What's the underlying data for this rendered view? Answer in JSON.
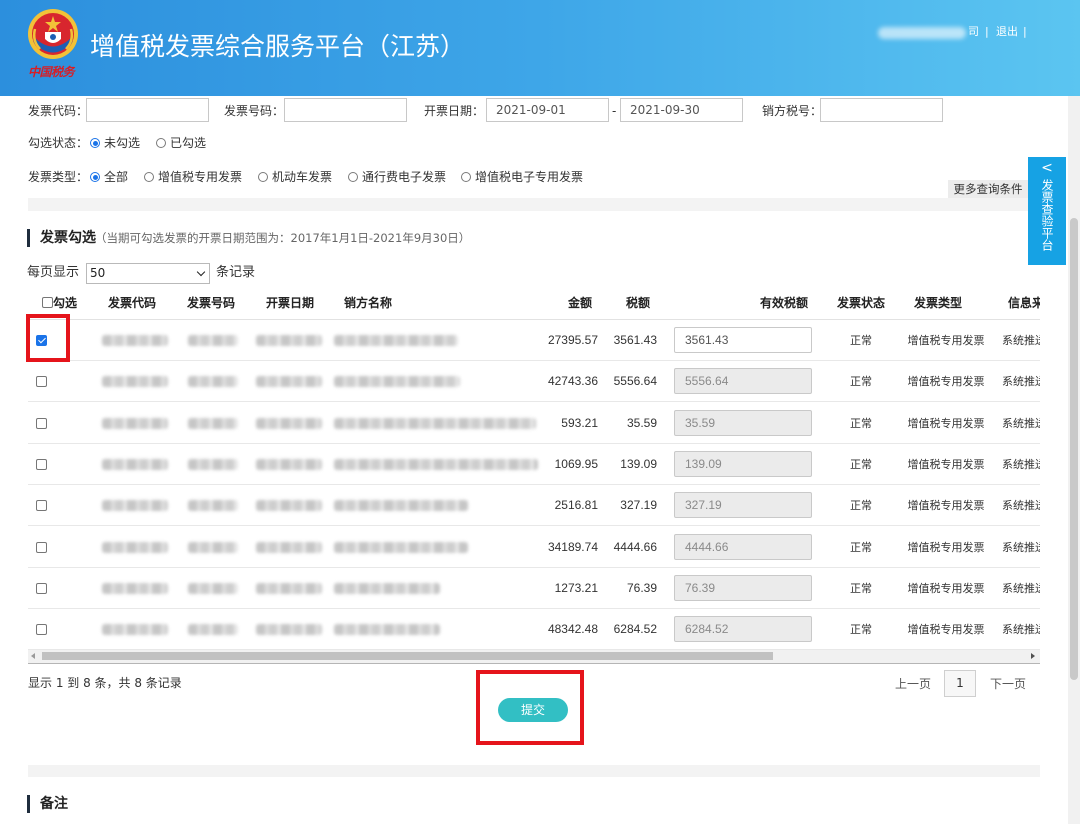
{
  "header": {
    "logo_text": "中国税务",
    "title": "增值税发票综合服务平台（江苏）",
    "company_suffix": "司",
    "separator": "|",
    "logout": "退出"
  },
  "filters": {
    "invoice_code": {
      "label": "发票代码：",
      "value": ""
    },
    "invoice_number": {
      "label": "发票号码：",
      "value": ""
    },
    "invoice_date": {
      "label": "开票日期：",
      "from": "2021-09-01",
      "separator": "-",
      "to": "2021-09-30"
    },
    "seller_tax_id": {
      "label": "销方税号：",
      "value": ""
    },
    "check_status": {
      "label": "勾选状态：",
      "options": [
        {
          "label": "未勾选",
          "selected": true
        },
        {
          "label": "已勾选",
          "selected": false
        }
      ]
    },
    "invoice_type": {
      "label": "发票类型：",
      "options": [
        {
          "label": "全部",
          "selected": true
        },
        {
          "label": "增值税专用发票",
          "selected": false
        },
        {
          "label": "机动车发票",
          "selected": false
        },
        {
          "label": "通行费电子发票",
          "selected": false
        },
        {
          "label": "增值税电子专用发票",
          "selected": false
        }
      ]
    },
    "more_conditions": "更多查询条件"
  },
  "side_tab": {
    "arrow": "<",
    "label": "发票查验平台"
  },
  "selection_section": {
    "title": "发票勾选",
    "note": "（当期可勾选发票的开票日期范围为：2017年1月1日-2021年9月30日）",
    "page_size": {
      "prefix": "每页显示",
      "value": "50",
      "suffix": "条记录"
    }
  },
  "table": {
    "columns": [
      "勾选",
      "发票代码",
      "发票号码",
      "开票日期",
      "销方名称",
      "金额",
      "税额",
      "有效税额",
      "发票状态",
      "发票类型",
      "信息来源"
    ],
    "select_all_checked": false,
    "rows": [
      {
        "checked": true,
        "amount": "27395.57",
        "tax": "3561.43",
        "effective_tax": "3561.43",
        "effective_tax_editable": true,
        "status": "正常",
        "type": "增值税专用发票",
        "source": "系统推送"
      },
      {
        "checked": false,
        "amount": "42743.36",
        "tax": "5556.64",
        "effective_tax": "5556.64",
        "effective_tax_editable": false,
        "status": "正常",
        "type": "增值税专用发票",
        "source": "系统推送"
      },
      {
        "checked": false,
        "amount": "593.21",
        "tax": "35.59",
        "effective_tax": "35.59",
        "effective_tax_editable": false,
        "status": "正常",
        "type": "增值税专用发票",
        "source": "系统推送"
      },
      {
        "checked": false,
        "amount": "1069.95",
        "tax": "139.09",
        "effective_tax": "139.09",
        "effective_tax_editable": false,
        "status": "正常",
        "type": "增值税专用发票",
        "source": "系统推送"
      },
      {
        "checked": false,
        "amount": "2516.81",
        "tax": "327.19",
        "effective_tax": "327.19",
        "effective_tax_editable": false,
        "status": "正常",
        "type": "增值税专用发票",
        "source": "系统推送"
      },
      {
        "checked": false,
        "amount": "34189.74",
        "tax": "4444.66",
        "effective_tax": "4444.66",
        "effective_tax_editable": false,
        "status": "正常",
        "type": "增值税专用发票",
        "source": "系统推送"
      },
      {
        "checked": false,
        "amount": "1273.21",
        "tax": "76.39",
        "effective_tax": "76.39",
        "effective_tax_editable": false,
        "status": "正常",
        "type": "增值税专用发票",
        "source": "系统推送"
      },
      {
        "checked": false,
        "amount": "48342.48",
        "tax": "6284.52",
        "effective_tax": "6284.52",
        "effective_tax_editable": false,
        "status": "正常",
        "type": "增值税专用发票",
        "source": "系统推送"
      }
    ],
    "summary": "显示 1 到 8 条，共 8 条记录",
    "pagination": {
      "prev": "上一页",
      "current": "1",
      "next": "下一页"
    },
    "submit": "提交"
  },
  "remarks_section": {
    "title": "备注"
  },
  "colors": {
    "header_start": "#2c8fdd",
    "header_end": "#5bc5f1",
    "accent": "#1a73e8",
    "submit": "#32bfc4",
    "highlight": "#e5141b",
    "side_tab": "#16a2e4"
  }
}
